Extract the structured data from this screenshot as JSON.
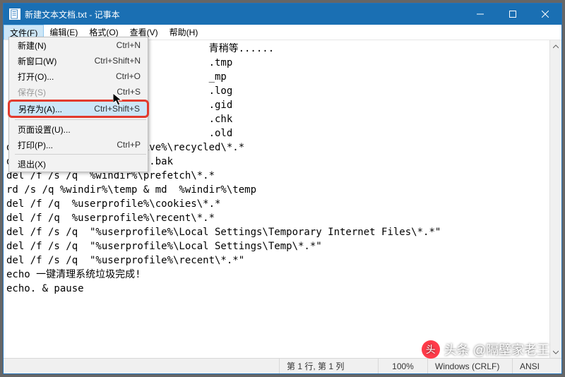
{
  "window": {
    "title": "新建文本文档.txt - 记事本"
  },
  "menus": {
    "file": "文件(F)",
    "edit": "编辑(E)",
    "format": "格式(O)",
    "view": "查看(V)",
    "help": "帮助(H)"
  },
  "file_menu": {
    "new": {
      "label": "新建(N)",
      "accel": "Ctrl+N"
    },
    "new_window": {
      "label": "新窗口(W)",
      "accel": "Ctrl+Shift+N"
    },
    "open": {
      "label": "打开(O)...",
      "accel": "Ctrl+O"
    },
    "save": {
      "label": "保存(S)",
      "accel": "Ctrl+S"
    },
    "save_as": {
      "label": "另存为(A)...",
      "accel": "Ctrl+Shift+S"
    },
    "page_setup": {
      "label": "页面设置(U)...",
      "accel": ""
    },
    "print": {
      "label": "打印(P)...",
      "accel": "Ctrl+P"
    },
    "exit": {
      "label": "退出(X)",
      "accel": ""
    }
  },
  "editor_lines": [
    "                                  青稍等......",
    "                                  .tmp",
    "                                  _mp",
    "                                  .log",
    "                                  .gid",
    "                                  .chk",
    "                                  .old",
    "del /f /s /q  %systemdrive%\\recycled\\*.*",
    "del /f /s /q  %windir%\\*.bak",
    "del /f /s /q  %windir%\\prefetch\\*.*",
    "rd /s /q %windir%\\temp & md  %windir%\\temp",
    "del /f /q  %userprofile%\\cookies\\*.*",
    "del /f /q  %userprofile%\\recent\\*.*",
    "del /f /s /q  \"%userprofile%\\Local Settings\\Temporary Internet Files\\*.*\"",
    "del /f /s /q  \"%userprofile%\\Local Settings\\Temp\\*.*\"",
    "del /f /s /q  \"%userprofile%\\recent\\*.*\"",
    "echo 一键清理系统垃圾完成!",
    "echo. & pause"
  ],
  "statusbar": {
    "caret": "第 1 行, 第 1 列",
    "zoom": "100%",
    "eol": "Windows (CRLF)",
    "encoding": "ANSI"
  },
  "watermark": {
    "text": "头条 @隔壁家老王",
    "icon_glyph": "头"
  }
}
